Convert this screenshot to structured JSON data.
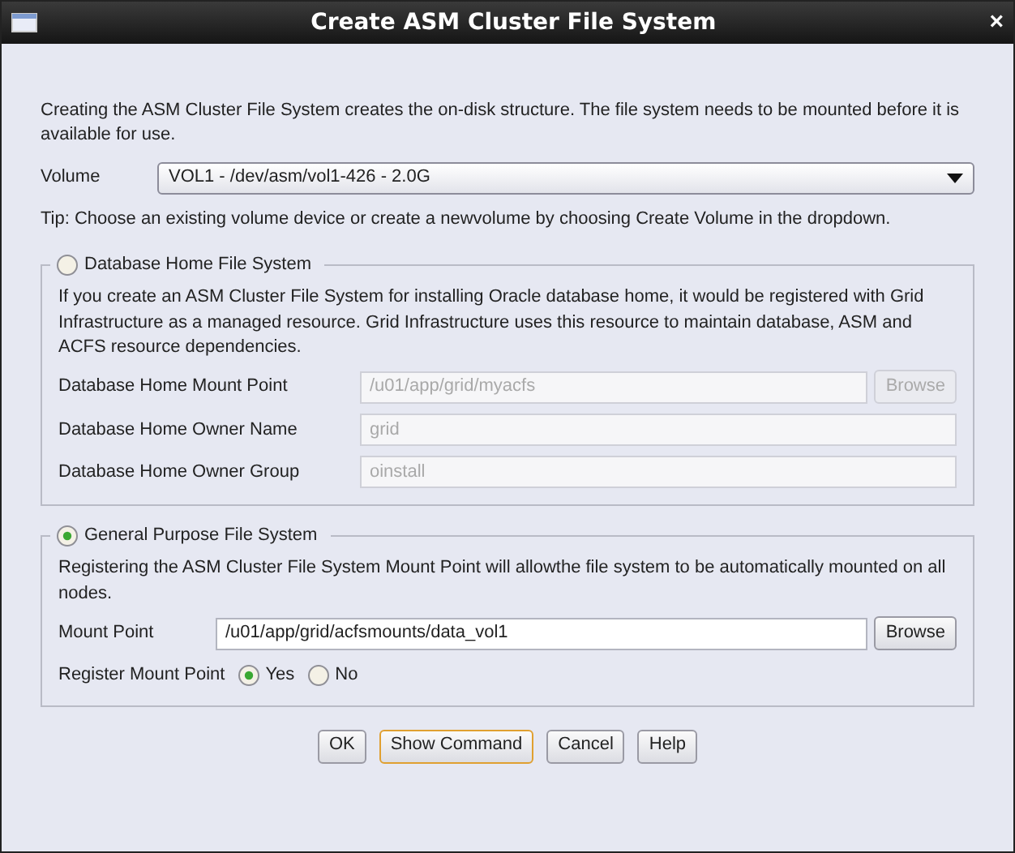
{
  "window": {
    "title": "Create ASM Cluster File System",
    "close": "×"
  },
  "intro": "Creating the ASM Cluster File System creates the on-disk structure. The file system needs to be mounted before it is available for use.",
  "volume": {
    "label": "Volume",
    "value": "VOL1 - /dev/asm/vol1-426 - 2.0G"
  },
  "tip": "Tip: Choose an existing volume device or create a newvolume by choosing Create Volume in the dropdown.",
  "sections": [
    {
      "label": "Database Home File System",
      "selected": false,
      "description": "If you create an ASM Cluster File System for installing Oracle database home, it would be registered with Grid Infrastructure as a managed resource. Grid Infrastructure uses this resource to maintain database, ASM and ACFS resource dependencies.",
      "fields": [
        {
          "kind": "text",
          "label": "Database Home Mount Point",
          "value": "/u01/app/grid/myacfs",
          "button": "Browse"
        },
        {
          "kind": "text",
          "label": "Database Home Owner Name",
          "value": "grid"
        },
        {
          "kind": "text",
          "label": "Database Home Owner Group",
          "value": "oinstall"
        }
      ]
    },
    {
      "label": "General Purpose File System",
      "selected": true,
      "description": "Registering the ASM Cluster File System Mount Point will allowthe file system to be automatically mounted on all nodes.",
      "fields": [
        {
          "kind": "text",
          "label": "Mount Point",
          "value": "/u01/app/grid/acfsmounts/data_vol1",
          "button": "Browse"
        },
        {
          "kind": "radios",
          "label": "Register Mount Point",
          "options": [
            {
              "label": "Yes",
              "selected": true
            },
            {
              "label": "No",
              "selected": false
            }
          ]
        }
      ]
    }
  ],
  "buttons": [
    {
      "label": "OK",
      "focused": false
    },
    {
      "label": "Show Command",
      "focused": true
    },
    {
      "label": "Cancel",
      "focused": false
    },
    {
      "label": "Help",
      "focused": false
    }
  ]
}
